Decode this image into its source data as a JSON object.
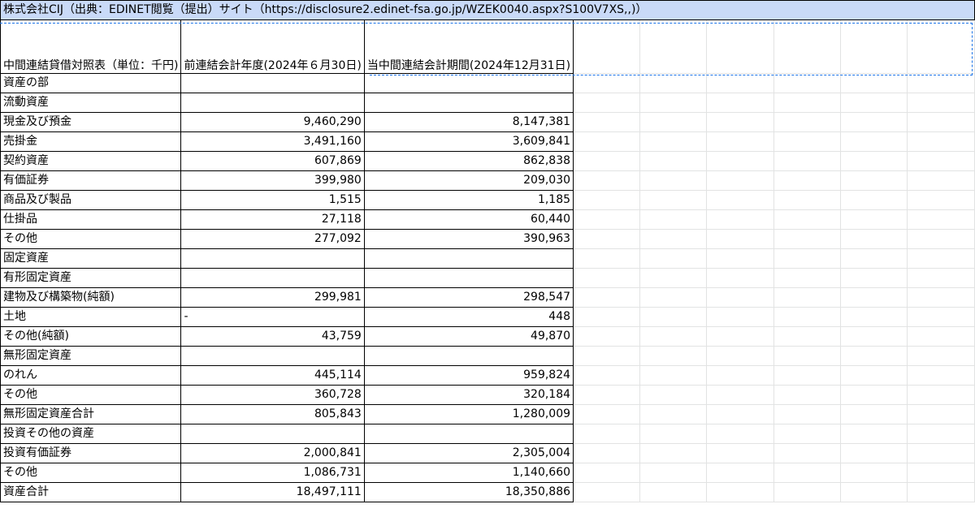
{
  "title": "株式会社CIJ（出典：EDINET閲覧（提出）サイト（https://disclosure2.edinet-fsa.go.jp/WZEK0040.aspx?S100V7XS,,)）",
  "headers": {
    "col1": "中間連結貸借対照表（単位：千円)",
    "col2": "前連結会計年度(2024年６月30日)",
    "col3": "当中間連結会計期間(2024年12月31日)"
  },
  "rows": [
    {
      "label": "資産の部",
      "prev": "",
      "curr": ""
    },
    {
      "label": "流動資産",
      "prev": "",
      "curr": ""
    },
    {
      "label": "現金及び預金",
      "prev": "9,460,290",
      "curr": "8,147,381"
    },
    {
      "label": "売掛金",
      "prev": "3,491,160",
      "curr": "3,609,841"
    },
    {
      "label": "契約資産",
      "prev": "607,869",
      "curr": "862,838"
    },
    {
      "label": "有価証券",
      "prev": "399,980",
      "curr": "209,030"
    },
    {
      "label": "商品及び製品",
      "prev": "1,515",
      "curr": "1,185"
    },
    {
      "label": "仕掛品",
      "prev": "27,118",
      "curr": "60,440"
    },
    {
      "label": "その他",
      "prev": "277,092",
      "curr": "390,963"
    },
    {
      "label": "固定資産",
      "prev": "",
      "curr": ""
    },
    {
      "label": "有形固定資産",
      "prev": "",
      "curr": ""
    },
    {
      "label": "建物及び構築物(純額)",
      "prev": "299,981",
      "curr": "298,547"
    },
    {
      "label": "土地",
      "prev": "-",
      "curr": "448"
    },
    {
      "label": "その他(純額)",
      "prev": "43,759",
      "curr": "49,870"
    },
    {
      "label": "無形固定資産",
      "prev": "",
      "curr": ""
    },
    {
      "label": "のれん",
      "prev": "445,114",
      "curr": "959,824"
    },
    {
      "label": "その他",
      "prev": "360,728",
      "curr": "320,184"
    },
    {
      "label": "無形固定資産合計",
      "prev": "805,843",
      "curr": "1,280,009"
    },
    {
      "label": "投資その他の資産",
      "prev": "",
      "curr": ""
    },
    {
      "label": "投資有価証券",
      "prev": "2,000,841",
      "curr": "2,305,004"
    },
    {
      "label": "その他",
      "prev": "1,086,731",
      "curr": "1,140,660"
    },
    {
      "label": "資産合計",
      "prev": "18,497,111",
      "curr": "18,350,886"
    }
  ],
  "colors": {
    "title_fill": "#c9daf8",
    "selection": "#1a73e8",
    "gridline": "#e2e3e3"
  }
}
